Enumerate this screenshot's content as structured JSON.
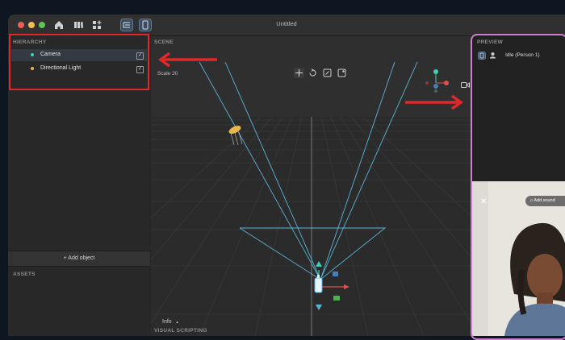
{
  "window": {
    "title": "Untitled"
  },
  "hierarchy": {
    "label": "HIERARCHY",
    "items": [
      {
        "label": "Camera",
        "checked": true,
        "icon": "camera-dot-icon"
      },
      {
        "label": "Directional Light",
        "checked": true,
        "icon": "sun-icon"
      }
    ],
    "check_glyph": "✓"
  },
  "add_object": "+ Add object",
  "assets": {
    "label": "ASSETS"
  },
  "scene": {
    "label": "SCENE",
    "scale_text": "Scale 20",
    "info": "Info",
    "info_caret": "▲"
  },
  "visual_scripting": {
    "label": "VISUAL SCRIPTING"
  },
  "preview": {
    "label": "PREVIEW",
    "animation": "Idle (Person 1)",
    "add_sound": "Add sound",
    "close_glyph": "✕"
  },
  "colors": {
    "accent_red": "#e0282a",
    "preview_border": "#cf7fd0",
    "frustum": "#5ab4d8"
  }
}
